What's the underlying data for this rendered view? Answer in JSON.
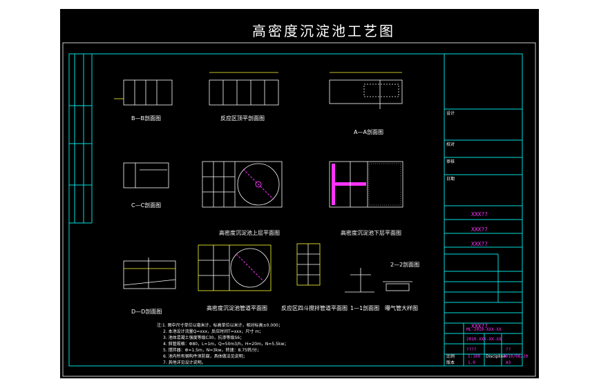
{
  "drawing_title": "高密度沉淀池工艺图",
  "colors": {
    "background": "#000000",
    "frame": "#00e0e0",
    "line": "#ffffff",
    "accent": "#ff33ff",
    "dims": "#ffff33"
  },
  "views": {
    "bb": "B—B剖面图",
    "plan_section": "反应区顶平剖面图",
    "aa": "A—A剖面图",
    "cc": "C—C剖面图",
    "upper_plan": "高密度沉淀池上层平面图",
    "lower_plan": "高密度沉淀池下层平面图",
    "dd": "D—D剖面图",
    "pipe_plan": "高密度沉淀池管道平面图",
    "mixer_detail": "反应区四斗搅拌管道平面图",
    "pipe_section": "1—1剖面图",
    "aeration": "曝气管大样图",
    "section22": "2—2剖面图"
  },
  "notes": [
    "注:1. 图中尺寸单位以毫米计，标高单位以米计，相对标高±0.000；",
    "2. 本池设计流量Q=xxx，反应时间T=xxx，尺寸 m；",
    "3. 池体混凝土强度等级C30，抗渗等级S6；",
    "4. 斜管规格：Φ80，L=1m，Q=50m3/h，H=20m，N=5.5kw；",
    "5. 搅拌器：Φ=1.5m，N=3kw，转速：8.75转/分；",
    "6. 池内所有钢构件须防腐，具体做法见说明；",
    "7. 其他详见设计说明。"
  ],
  "title_block": {
    "designed": "设计",
    "checked": "校对",
    "reviewed": "审核",
    "date": "日期",
    "scale_label": "比例",
    "scale_value": "1:100",
    "version_label": "版本",
    "version_value": "1.0",
    "size_value": "A3",
    "project": "XXX??",
    "sub_project": "XXX??",
    "client": "XXX??",
    "task": "XXX??",
    "drawing_no": "ML-2010-XXX-XX",
    "project_no": "2010-XXX-XX-XX",
    "field_a": "????",
    "field_b": "??",
    "date_value": "2010/08/20",
    "discipline": "Discipline"
  }
}
